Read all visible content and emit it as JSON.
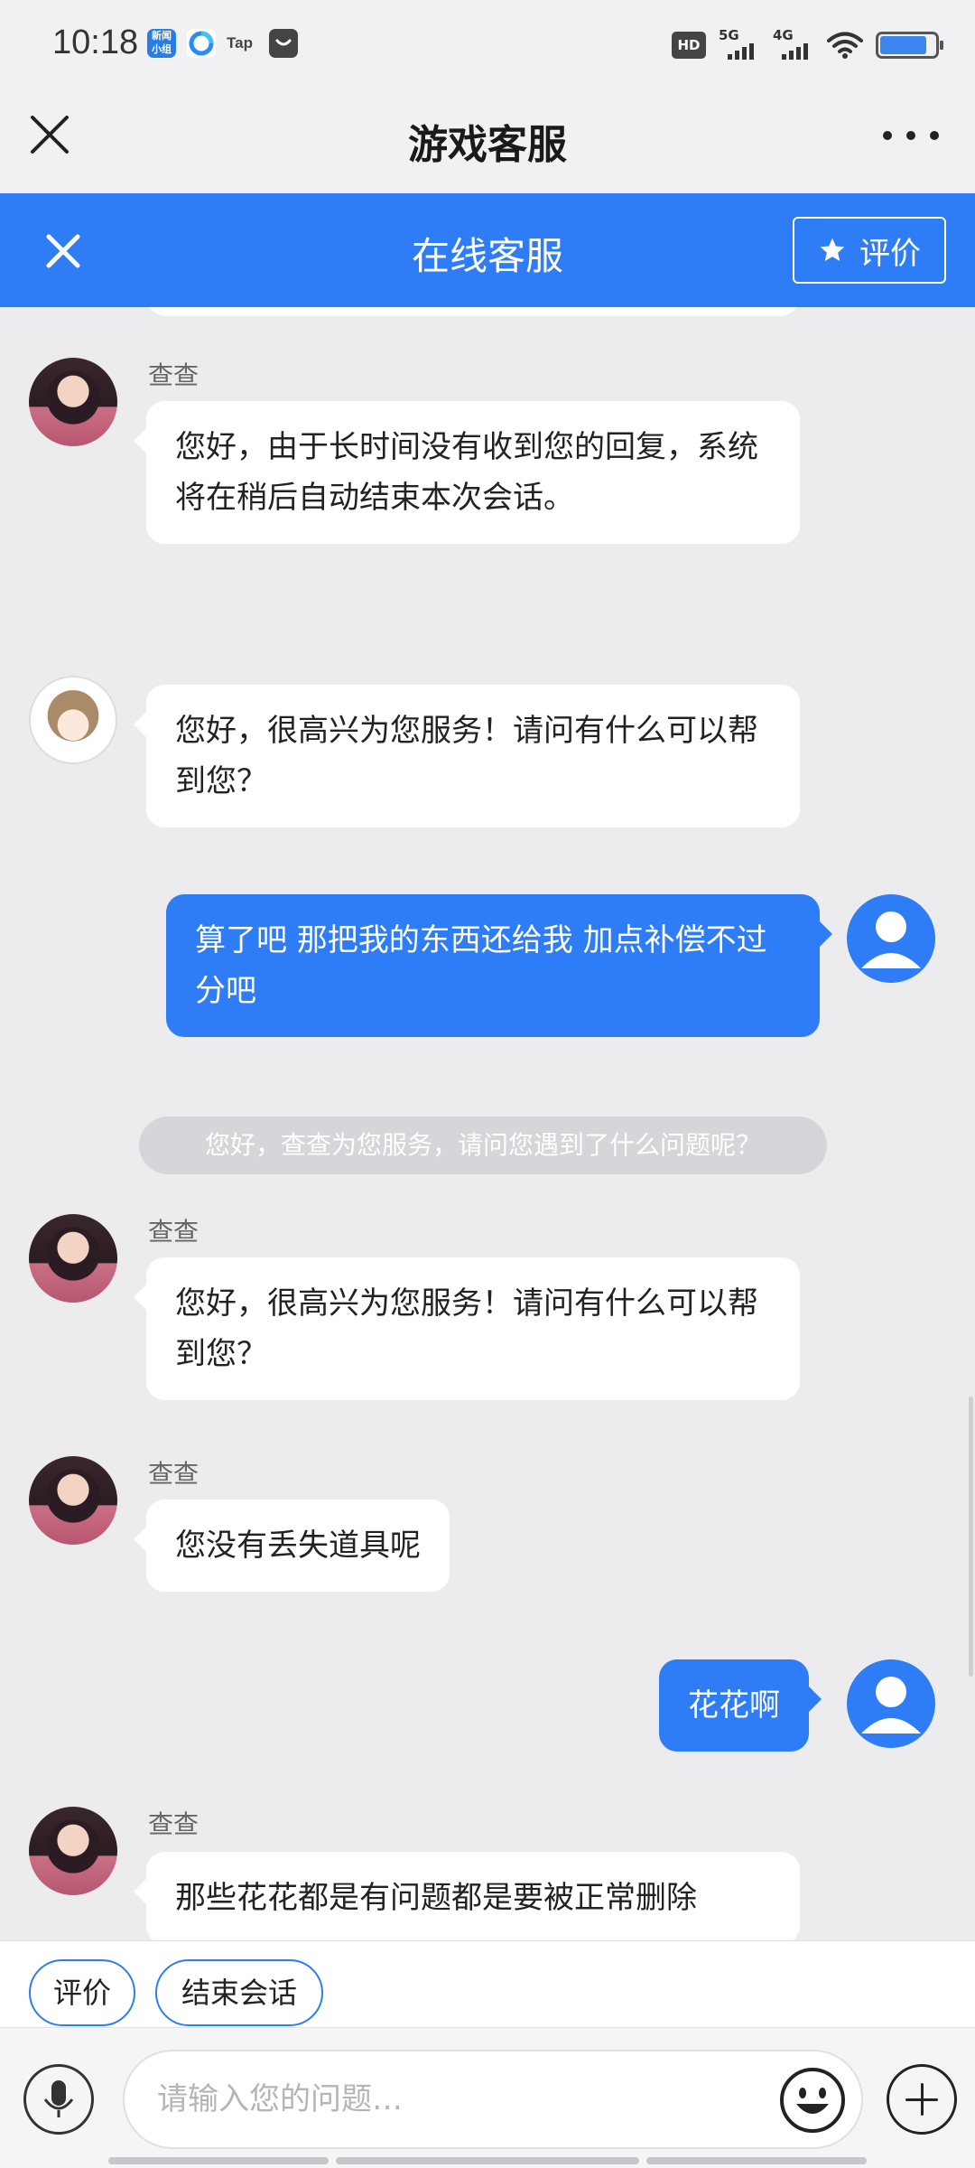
{
  "status_bar": {
    "time": "10:18",
    "app_icons": [
      "news-app-icon",
      "browser-app-icon",
      "tap-app-icon",
      "message-app-icon"
    ],
    "tap_label": "Tap",
    "hd_label": "HD",
    "signal_5g": "5G",
    "signal_4g": "4G",
    "battery_level": 0.85
  },
  "nav": {
    "title": "游戏客服"
  },
  "cs_header": {
    "title": "在线客服",
    "rate_label": "评价"
  },
  "messages": [
    {
      "sender": "agent",
      "name": "查查",
      "text": "您好，由于长时间没有收到您的回复，系统将在稍后自动结束本次会话。"
    },
    {
      "sender": "bot",
      "text": "您好，很高兴为您服务！请问有什么可以帮到您？"
    },
    {
      "sender": "user",
      "text": "算了吧  那把我的东西还给我  加点补偿不过分吧"
    },
    {
      "sender": "system",
      "text": "您好，查查为您服务，请问您遇到了什么问题呢？"
    },
    {
      "sender": "agent",
      "name": "查查",
      "text": "您好，很高兴为您服务！请问有什么可以帮到您？"
    },
    {
      "sender": "agent",
      "name": "查查",
      "text": "您没有丢失道具呢"
    },
    {
      "sender": "user",
      "text": "花花啊"
    },
    {
      "sender": "agent",
      "name": "查查",
      "text": "那些花花都是有问题都是要被正常删除"
    }
  ],
  "quick_actions": [
    "评价",
    "结束会话"
  ],
  "input": {
    "placeholder": "请输入您的问题…",
    "value": ""
  },
  "colors": {
    "accent": "#2e7cf6",
    "background": "#ececee"
  }
}
